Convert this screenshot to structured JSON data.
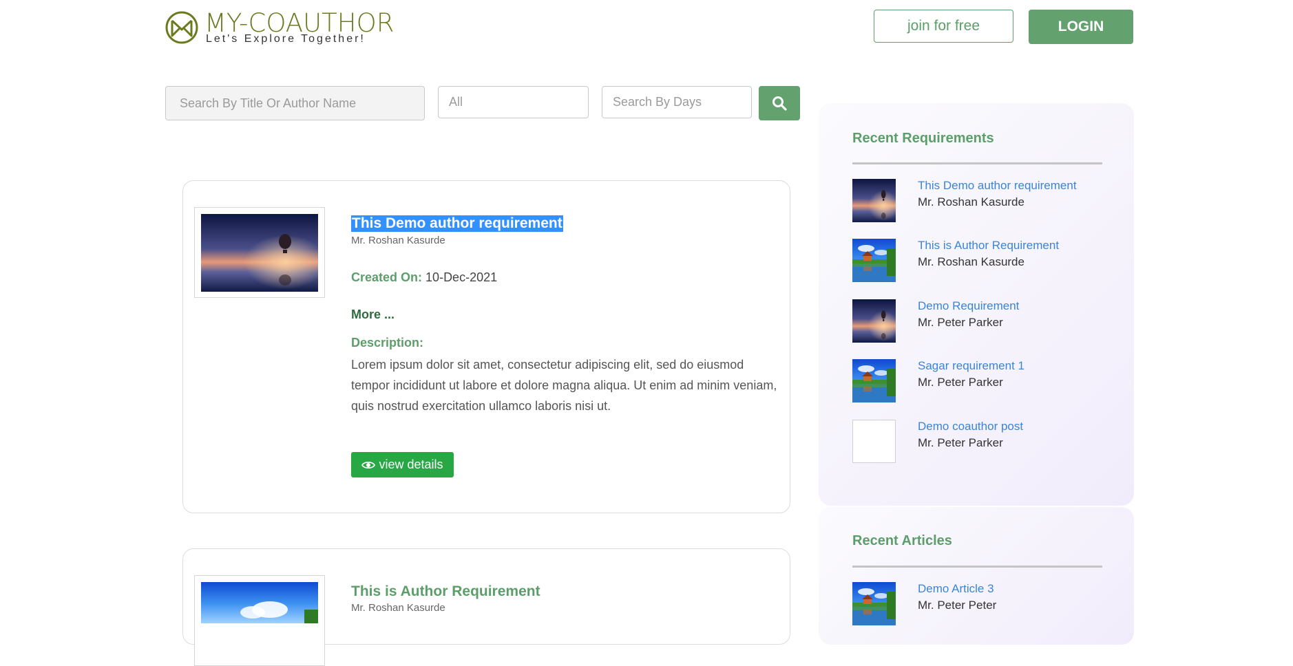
{
  "header": {
    "logo_title": "MY-COAUTHOR",
    "logo_subtitle": "Let's Explore Together!",
    "join_label": "join for free",
    "login_label": "LOGIN"
  },
  "search": {
    "title_placeholder": "Search By Title Or Author Name",
    "category_value": "All",
    "days_placeholder": "Search By Days"
  },
  "posts": [
    {
      "title": "This Demo author requirement",
      "author": "Mr. Roshan Kasurde",
      "created_label": "Created On:",
      "created_value": "10-Dec-2021",
      "more_label": "More ...",
      "description_label": "Description:",
      "description": "Lorem ipsum dolor sit amet, consectetur adipiscing elit, sed do eiusmod tempor incididunt ut labore et dolore magna aliqua. Ut enim ad minim veniam, quis nostrud exercitation ullamco laboris nisi ut.",
      "view_label": "view details"
    },
    {
      "title": "This is Author Requirement",
      "author": "Mr. Roshan Kasurde"
    }
  ],
  "sidebar": {
    "recent_requirements": {
      "heading": "Recent Requirements",
      "items": [
        {
          "title": "This Demo author requirement",
          "author": "Mr. Roshan Kasurde",
          "image": "balloon-night"
        },
        {
          "title": "This is Author Requirement",
          "author": "Mr. Roshan Kasurde",
          "image": "lake-house"
        },
        {
          "title": "Demo Requirement",
          "author": "Mr. Peter Parker",
          "image": "balloon-night"
        },
        {
          "title": "Sagar requirement 1",
          "author": "Mr. Peter Parker",
          "image": "lake-house"
        },
        {
          "title": "Demo coauthor post",
          "author": "Mr. Peter Parker",
          "image": "none"
        }
      ]
    },
    "recent_articles": {
      "heading": "Recent Articles",
      "items": [
        {
          "title": "Demo Article 3",
          "author": "Mr. Peter Peter",
          "image": "lake-house"
        }
      ]
    }
  },
  "colors": {
    "brand_green": "#63a16e",
    "view_button": "#28a745",
    "link_blue": "#3a84d6",
    "selection": "#3390ff"
  }
}
